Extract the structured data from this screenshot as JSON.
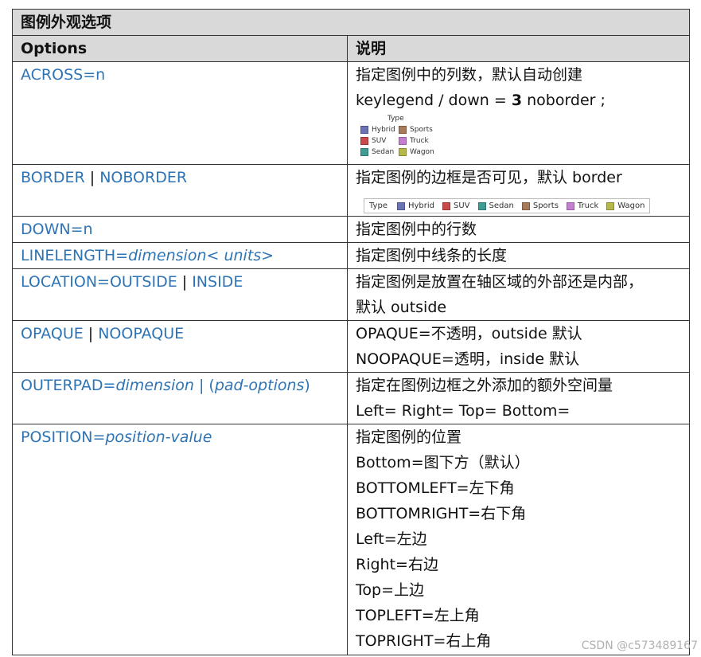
{
  "table": {
    "caption": "图例外观选项",
    "headers": {
      "options": "Options",
      "description": "说明"
    },
    "rows": [
      {
        "opt": "ACROSS=n",
        "desc": [
          "指定图例中的列数，默认自动创建"
        ],
        "desc2_prefix": "keylegend / down = ",
        "desc2_bold": "3",
        "desc2_suffix": " noborder ;"
      },
      {
        "opt_a": "BORDER",
        "opt_sep": " | ",
        "opt_b": "NOBORDER",
        "desc": [
          "指定图例的边框是否可见，默认 border"
        ]
      },
      {
        "opt": "DOWN=n",
        "desc": [
          "指定图例中的行数"
        ]
      },
      {
        "opt_plain": "LINELENGTH=",
        "opt_italic": "dimension< units>",
        "desc": [
          "指定图例中线条的长度"
        ]
      },
      {
        "opt_a": "LOCATION=OUTSIDE",
        "opt_sep": " | ",
        "opt_b": "INSIDE",
        "desc": [
          "指定图例是放置在轴区域的外部还是内部，",
          "默认 outside"
        ]
      },
      {
        "opt_a": "OPAQUE",
        "opt_sep": " | ",
        "opt_b": "NOOPAQUE",
        "desc": [
          "OPAQUE=不透明，outside 默认",
          "NOOPAQUE=透明，inside 默认"
        ]
      },
      {
        "opt_plain": "OUTERPAD=",
        "opt_italic": "dimension",
        "opt_sep": " | (",
        "opt_italic2": "pad-options",
        "opt_end": ")",
        "desc": [
          "指定在图例边框之外添加的额外空间量",
          "Left= Right= Top= Bottom="
        ]
      },
      {
        "opt_plain": "POSITION=",
        "opt_italic": "position-value",
        "desc": [
          "指定图例的位置",
          "Bottom=图下方（默认）",
          "BOTTOMLEFT=左下角",
          "BOTTOMRIGHT=右下角",
          "Left=左边",
          "Right=右边",
          "Top=上边",
          "TOPLEFT=左上角",
          "TOPRIGHT=右上角"
        ]
      }
    ]
  },
  "legend_example": {
    "title": "Type",
    "items": [
      {
        "label": "Hybrid",
        "color": "#6a73b5"
      },
      {
        "label": "Sports",
        "color": "#a77b5a"
      },
      {
        "label": "SUV",
        "color": "#c94a4a"
      },
      {
        "label": "Truck",
        "color": "#c47fd0"
      },
      {
        "label": "Sedan",
        "color": "#3f9c93"
      },
      {
        "label": "Wagon",
        "color": "#b6b84a"
      }
    ],
    "horizontal_order": [
      {
        "label": "Hybrid",
        "color": "#6a73b5"
      },
      {
        "label": "SUV",
        "color": "#c94a4a"
      },
      {
        "label": "Sedan",
        "color": "#3f9c93"
      },
      {
        "label": "Sports",
        "color": "#a77b5a"
      },
      {
        "label": "Truck",
        "color": "#c47fd0"
      },
      {
        "label": "Wagon",
        "color": "#b6b84a"
      }
    ]
  },
  "watermark": "CSDN @c573489167"
}
